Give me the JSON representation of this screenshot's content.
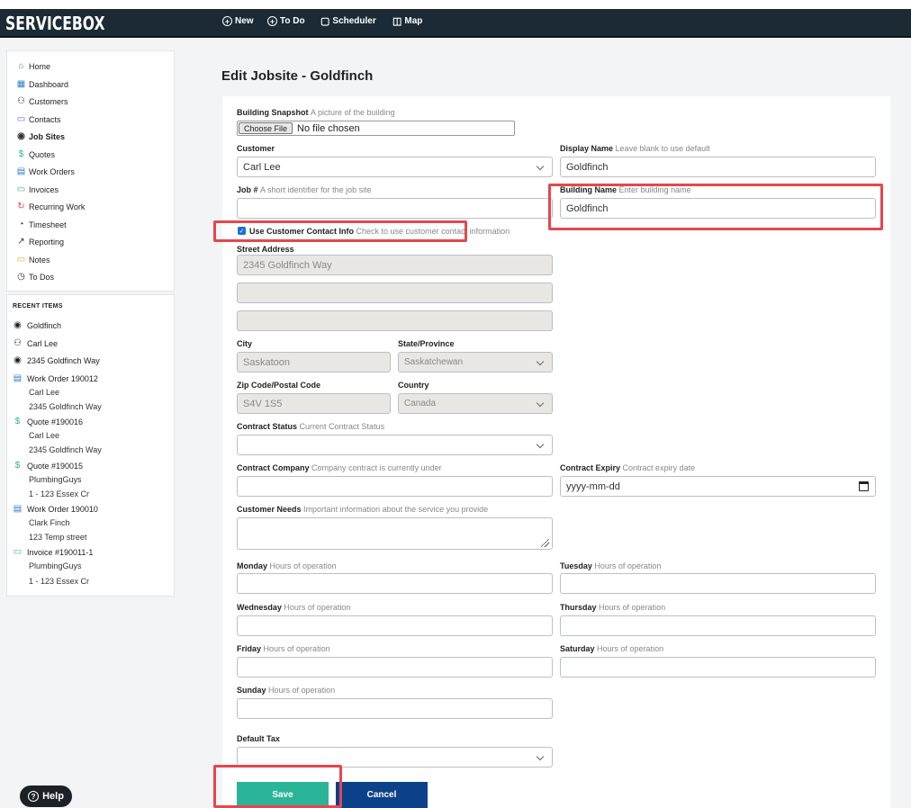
{
  "app": {
    "brand": "SERVICEBOX"
  },
  "nav": {
    "new": "New",
    "todo": "To Do",
    "scheduler": "Scheduler",
    "map": "Map"
  },
  "sidebar": {
    "items": [
      {
        "label": "Home",
        "icon": "home-icon"
      },
      {
        "label": "Dashboard",
        "icon": "dashboard-icon"
      },
      {
        "label": "Customers",
        "icon": "customers-icon"
      },
      {
        "label": "Contacts",
        "icon": "contacts-icon"
      },
      {
        "label": "Job Sites",
        "icon": "jobsite-icon",
        "active": true
      },
      {
        "label": "Quotes",
        "icon": "dollar-icon"
      },
      {
        "label": "Work Orders",
        "icon": "document-icon"
      },
      {
        "label": "Invoices",
        "icon": "invoice-icon"
      },
      {
        "label": "Recurring Work",
        "icon": "recurring-icon"
      },
      {
        "label": "Timesheet",
        "icon": "stopwatch-icon"
      },
      {
        "label": "Reporting",
        "icon": "chart-icon"
      },
      {
        "label": "Notes",
        "icon": "note-icon"
      },
      {
        "label": "To Dos",
        "icon": "clock-icon"
      }
    ]
  },
  "recent": {
    "title": "RECENT ITEMS",
    "items": [
      {
        "label": "Goldfinch",
        "icon": "location-icon",
        "sub": []
      },
      {
        "label": "Carl Lee",
        "icon": "user-icon",
        "sub": []
      },
      {
        "label": "2345 Goldfinch Way",
        "icon": "location-icon",
        "sub": []
      },
      {
        "label": "Work Order 190012",
        "icon": "document-icon",
        "sub": [
          "Carl Lee",
          "2345 Goldfinch Way"
        ]
      },
      {
        "label": "Quote #190016",
        "icon": "dollar-icon",
        "sub": [
          "Carl Lee",
          "2345 Goldfinch Way"
        ]
      },
      {
        "label": "Quote #190015",
        "icon": "dollar-icon",
        "sub": [
          "PlumbingGuys",
          "1 - 123 Essex Cr"
        ]
      },
      {
        "label": "Work Order 190010",
        "icon": "document-icon",
        "sub": [
          "Clark Finch",
          "123 Temp street"
        ]
      },
      {
        "label": "Invoice #190011-1",
        "icon": "invoice-icon",
        "sub": [
          "PlumbingGuys",
          "1 - 123 Essex Cr"
        ]
      }
    ]
  },
  "page": {
    "title": "Edit Jobsite - Goldfinch"
  },
  "form": {
    "snapshot": {
      "label": "Building Snapshot",
      "help": "A picture of the building",
      "button": "Choose File",
      "status": "No file chosen"
    },
    "customer": {
      "label": "Customer",
      "value": "Carl Lee"
    },
    "display_name": {
      "label": "Display Name",
      "help": "Leave blank to use default",
      "value": "Goldfinch"
    },
    "job_no": {
      "label": "Job #",
      "help": "A short identifier for the job site",
      "value": ""
    },
    "building_name": {
      "label": "Building Name",
      "help": "Enter building name",
      "value": "Goldfinch"
    },
    "use_contact": {
      "label": "Use Customer Contact Info",
      "help": "Check to use customer contact information",
      "checked": true,
      "mark": "✓"
    },
    "street": {
      "label": "Street Address",
      "line1": "2345 Goldfinch Way",
      "line2": "",
      "line3": ""
    },
    "city": {
      "label": "City",
      "value": "Saskatoon"
    },
    "state": {
      "label": "State/Province",
      "value": "Saskatchewan"
    },
    "zip": {
      "label": "Zip Code/Postal Code",
      "value": "S4V 1S5"
    },
    "country": {
      "label": "Country",
      "value": "Canada"
    },
    "contract_status": {
      "label": "Contract Status",
      "help": "Current Contract Status",
      "value": ""
    },
    "contract_company": {
      "label": "Contract Company",
      "help": "Company contract is currently under",
      "value": ""
    },
    "contract_expiry": {
      "label": "Contract Expiry",
      "help": "Contract expiry date",
      "placeholder": "yyyy-mm-dd"
    },
    "customer_needs": {
      "label": "Customer Needs",
      "help": "Important information about the service you provide"
    },
    "hours_help": "Hours of operation",
    "monday": "Monday",
    "tuesday": "Tuesday",
    "wednesday": "Wednesday",
    "thursday": "Thursday",
    "friday": "Friday",
    "saturday": "Saturday",
    "sunday": "Sunday",
    "default_tax": {
      "label": "Default Tax",
      "value": ""
    }
  },
  "actions": {
    "save": "Save",
    "cancel": "Cancel",
    "help": "Help",
    "help_glyph": "?"
  },
  "colors": {
    "topbar": "#1c2a35",
    "save": "#2bb598",
    "cancel": "#0c4189",
    "highlight": "#e4474d",
    "accent": "#2f80c0"
  }
}
